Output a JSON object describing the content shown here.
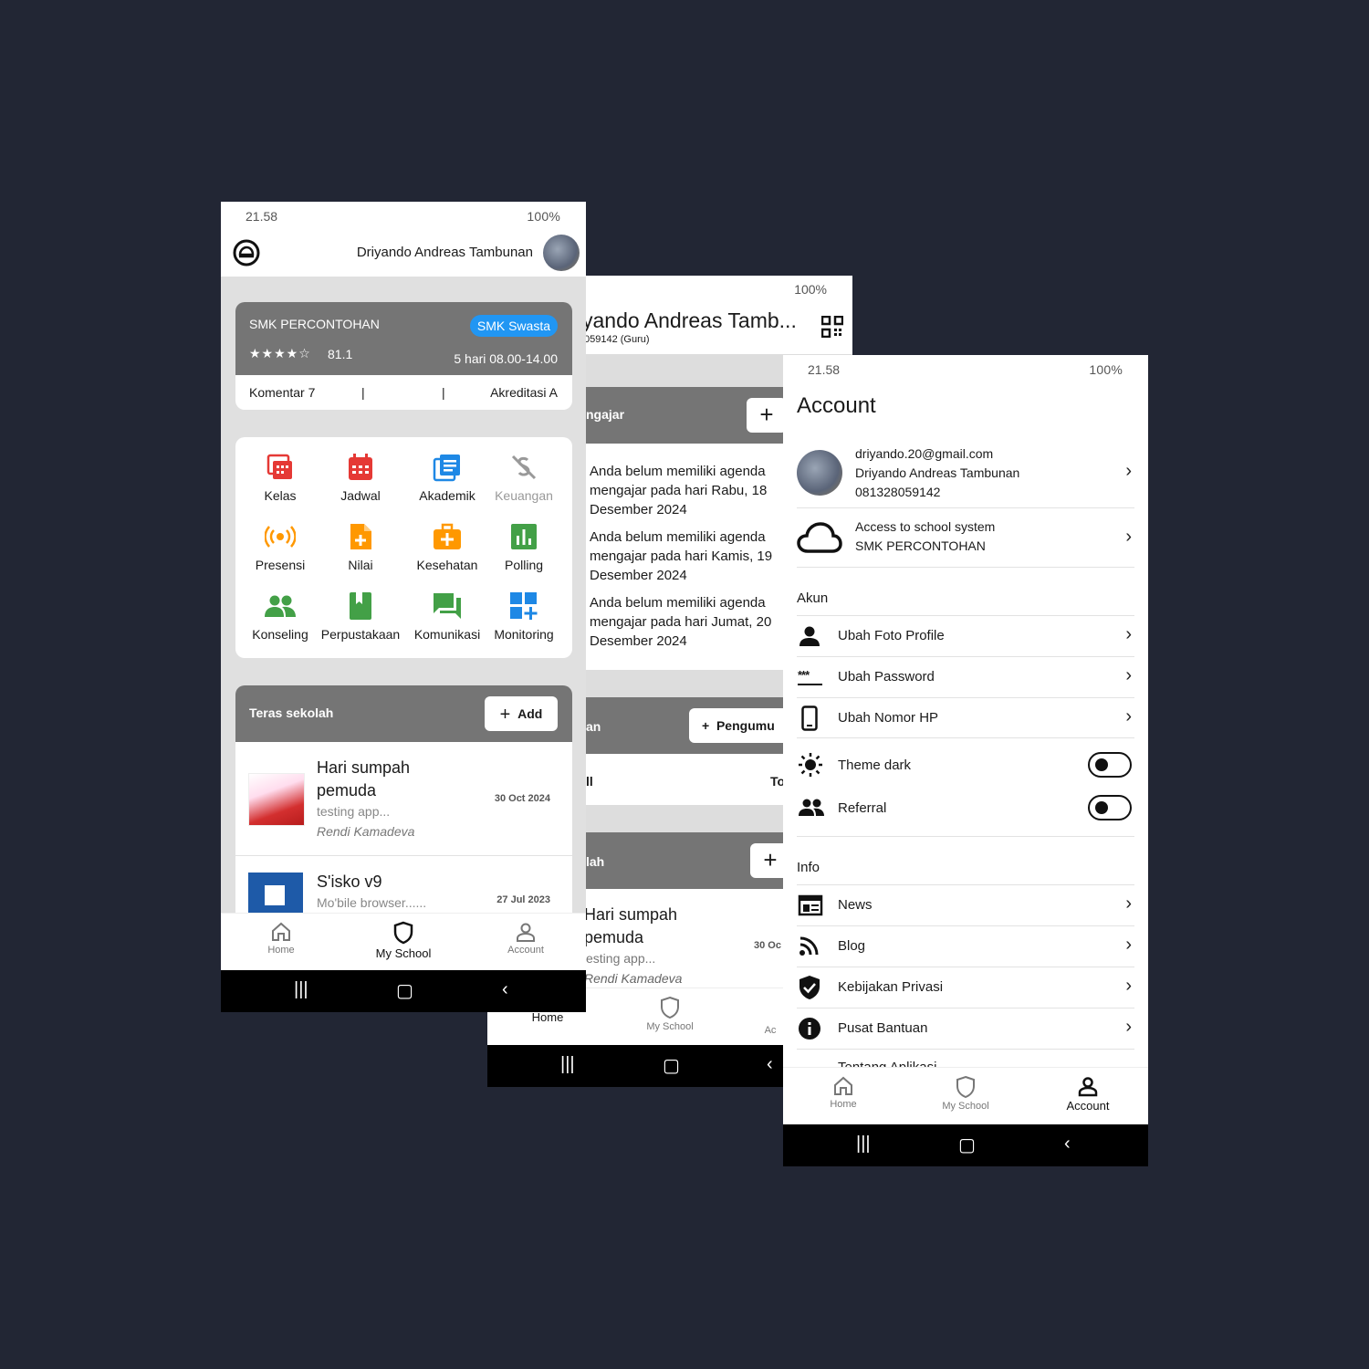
{
  "colors": {
    "background": "#222634",
    "card_header": "#757575",
    "accent_blue": "#2196F3",
    "red": "#e53935",
    "orange": "#ff9800",
    "green": "#43a047",
    "blue": "#1e88e5"
  },
  "phone1": {
    "status": {
      "time": "21.58",
      "right": "100%"
    },
    "user_name": "Driyando Andreas Tambunan",
    "school": {
      "name": "SMK PERCONTOHAN",
      "badge": "SMK Swasta",
      "stars": "★★★★☆",
      "rating": "81.1",
      "hours": "5 hari 08.00-14.00",
      "komentar": "Komentar 7",
      "sep1": "|",
      "sep2": "|",
      "akreditasi": "Akreditasi A"
    },
    "menu": [
      {
        "label": "Kelas",
        "icon": "kelas-icon"
      },
      {
        "label": "Jadwal",
        "icon": "jadwal-icon"
      },
      {
        "label": "Akademik",
        "icon": "akademik-icon"
      },
      {
        "label": "Keuangan",
        "icon": "keuangan-icon"
      },
      {
        "label": "Presensi",
        "icon": "presensi-icon"
      },
      {
        "label": "Nilai",
        "icon": "nilai-icon"
      },
      {
        "label": "Kesehatan",
        "icon": "kesehatan-icon"
      },
      {
        "label": "Polling",
        "icon": "polling-icon"
      },
      {
        "label": "Konseling",
        "icon": "konseling-icon"
      },
      {
        "label": "Perpustakaan",
        "icon": "perpustakaan-icon"
      },
      {
        "label": "Komunikasi",
        "icon": "komunikasi-icon"
      },
      {
        "label": "Monitoring",
        "icon": "monitoring-icon"
      }
    ],
    "teras": {
      "title": "Teras sekolah",
      "add": "Add",
      "posts": [
        {
          "title": "Hari sumpah pemuda",
          "subtitle": "testing app...",
          "author": "Rendi Kamadeva",
          "date": "30 Oct 2024"
        },
        {
          "title": "S'isko v9",
          "subtitle": "Mo'bile browser......",
          "date": "27 Jul 2023"
        }
      ]
    },
    "nav": {
      "home": "Home",
      "school": "My School",
      "account": "Account"
    }
  },
  "phone2": {
    "status": {
      "right": "100%"
    },
    "user_name": "yando Andreas Tamb...",
    "user_sub": "059142 (Guru)",
    "agenda_title": "ngajar",
    "agendas": [
      "Anda belum memiliki agenda mengajar pada hari Rabu, 18 Desember 2024",
      "Anda belum memiliki agenda mengajar pada hari Kamis, 19 Desember 2024",
      "Anda belum memiliki agenda mengajar pada hari Jumat, 20 Desember 2024"
    ],
    "section2_title": "an",
    "section2_btn": "Pengumu",
    "section2_row_left": "ll",
    "section2_row_right": "To",
    "section3_title": "lah",
    "post": {
      "title": "Hari sumpah pemuda",
      "subtitle": "esting app...",
      "author": "Rendi Kamadeva",
      "date": "30 Oc"
    },
    "nav": {
      "home": "Home",
      "school": "My School",
      "account": "Ac"
    }
  },
  "phone3": {
    "status": {
      "time": "21.58",
      "right": "100%"
    },
    "title": "Account",
    "profile": {
      "email": "driyando.20@gmail.com",
      "name": "Driyando Andreas Tambunan",
      "phone": "081328059142"
    },
    "access": {
      "line1": "Access to school system",
      "line2": "SMK PERCONTOHAN"
    },
    "akun_header": "Akun",
    "akun_items": [
      "Ubah Foto Profile",
      "Ubah Password",
      "Ubah Nomor HP"
    ],
    "theme_dark": "Theme dark",
    "referral": "Referral",
    "info_header": "Info",
    "info_items": [
      "News",
      "Blog",
      "Kebijakan Privasi",
      "Pusat Bantuan",
      "Tentang Aplikasi"
    ],
    "nav": {
      "home": "Home",
      "school": "My School",
      "account": "Account"
    }
  }
}
